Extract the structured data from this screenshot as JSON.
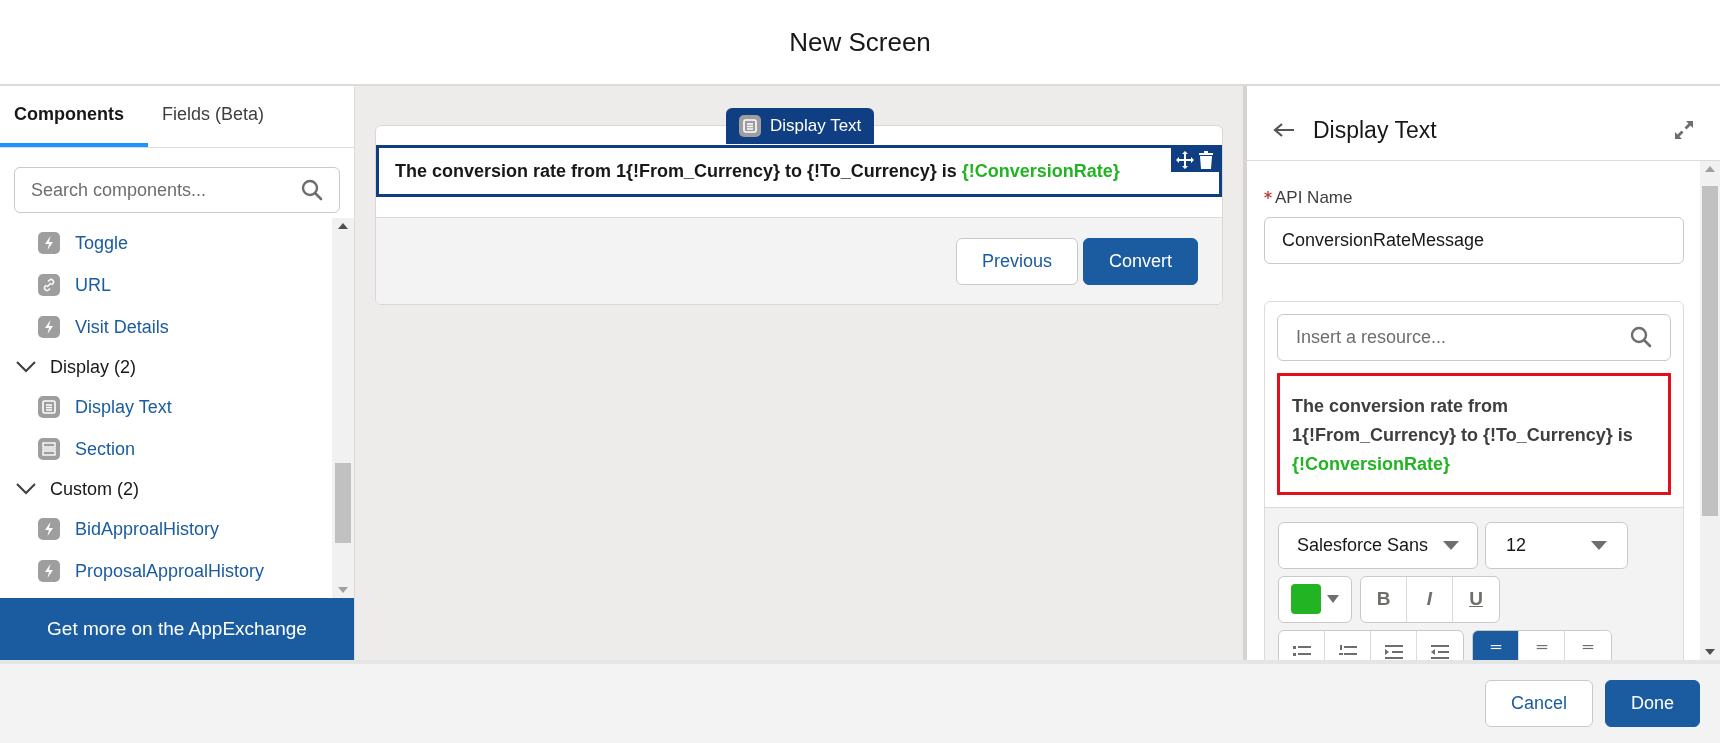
{
  "window": {
    "title": "New Screen"
  },
  "left_panel": {
    "tabs": [
      {
        "label": "Components",
        "selected": true
      },
      {
        "label": "Fields (Beta)",
        "selected": false
      }
    ],
    "search": {
      "placeholder": "Search components..."
    },
    "components": [
      {
        "kind": "custom",
        "label": "Toggle"
      },
      {
        "kind": "link",
        "label": "URL"
      },
      {
        "kind": "custom",
        "label": "Visit Details"
      },
      {
        "kind": "group",
        "label": "Display (2)",
        "expanded": true,
        "children": [
          {
            "kind": "text",
            "label": "Display Text"
          },
          {
            "kind": "section",
            "label": "Section"
          }
        ]
      },
      {
        "kind": "group",
        "label": "Custom (2)",
        "expanded": true,
        "children": [
          {
            "kind": "custom",
            "label": "BidApproalHistory"
          },
          {
            "kind": "custom",
            "label": "ProposalApproalHistory"
          }
        ]
      }
    ],
    "appexchange_button": "Get more on the AppExchange"
  },
  "canvas": {
    "component_tag": "Display Text",
    "display_text": [
      {
        "text": "The conversion rate from 1{!From_Currency} to {!To_Currency} is ",
        "color": "#181818"
      },
      {
        "text": "{!ConversionRate}",
        "color": "#22b422"
      }
    ],
    "buttons": [
      {
        "label": "Previous",
        "kind": "neutral"
      },
      {
        "label": "Convert",
        "kind": "brand"
      }
    ]
  },
  "properties": {
    "title": "Display Text",
    "api_name": {
      "label": "API Name",
      "required": true,
      "value": "ConversionRateMessage"
    },
    "resource_search": {
      "placeholder": "Insert a resource..."
    },
    "editor_text": [
      {
        "text": "The conversion rate from 1{!From_Currency} to {!To_Currency} is ",
        "color": "#3e3e3c"
      },
      {
        "text": "{!ConversionRate}",
        "color": "#22b422"
      }
    ],
    "font": "Salesforce Sans",
    "size": "12",
    "text_color": {
      "color": "#22b422"
    },
    "format_buttons": [
      "B",
      "I",
      "U"
    ],
    "align_buttons": [
      {
        "selected": true
      },
      {
        "selected": false
      },
      {
        "selected": false
      }
    ]
  },
  "footer": {
    "buttons": [
      {
        "label": "Cancel",
        "kind": "neutral"
      },
      {
        "label": "Done",
        "kind": "brand"
      }
    ]
  }
}
